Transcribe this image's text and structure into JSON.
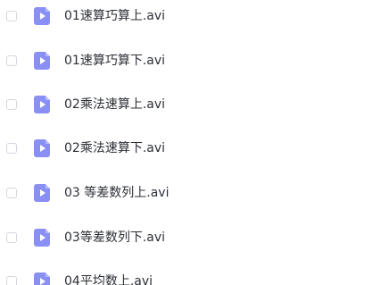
{
  "files": [
    {
      "name": "01速算巧算上.avi",
      "icon": "video-file-icon"
    },
    {
      "name": "01速算巧算下.avi",
      "icon": "video-file-icon"
    },
    {
      "name": "02乘法速算上.avi",
      "icon": "video-file-icon"
    },
    {
      "name": "02乘法速算下.avi",
      "icon": "video-file-icon"
    },
    {
      "name": "03 等差数列上.avi",
      "icon": "video-file-icon"
    },
    {
      "name": "03等差数列下.avi",
      "icon": "video-file-icon"
    },
    {
      "name": "04平均数上.avi",
      "icon": "video-file-icon"
    }
  ],
  "colors": {
    "icon": "#8a8ff5",
    "text": "#2b2f36",
    "checkbox_border": "#d4d7de"
  }
}
